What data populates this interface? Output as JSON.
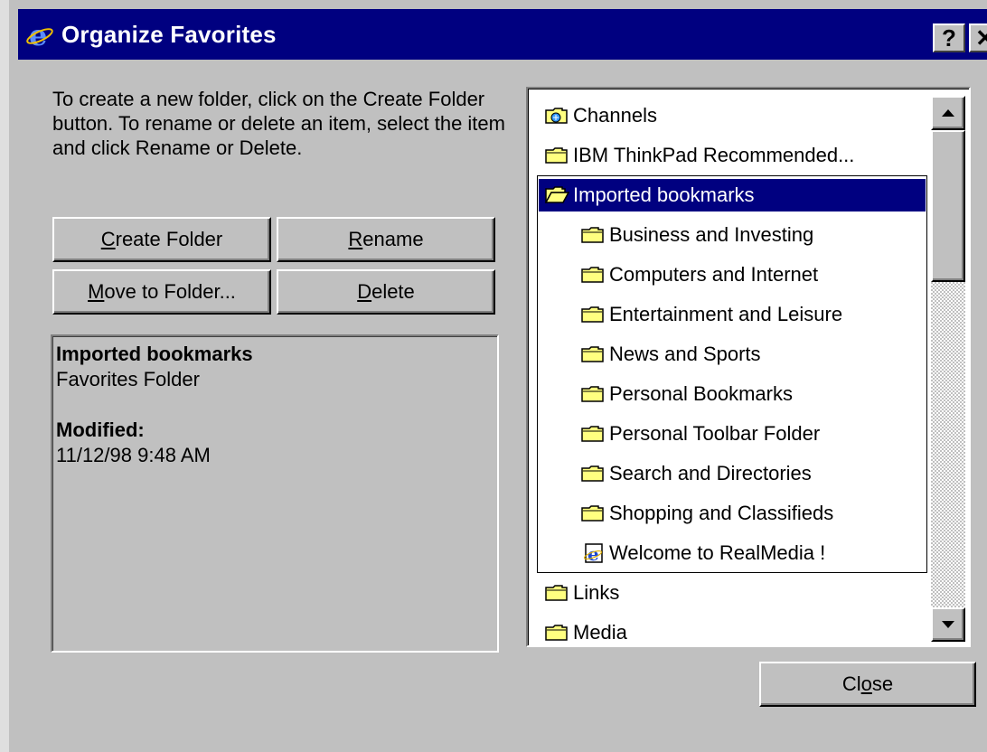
{
  "window": {
    "title": "Organize Favorites",
    "help_glyph": "?",
    "close_glyph": "✕"
  },
  "instructions": "To create a new folder, click on the Create Folder button. To rename or delete an item, select the item and click Rename or Delete.",
  "buttons": {
    "create_folder": {
      "mnemonic": "C",
      "rest": "reate Folder"
    },
    "rename": {
      "mnemonic": "R",
      "rest": "ename"
    },
    "move_to_folder": {
      "mnemonic": "M",
      "rest": "ove to Folder..."
    },
    "delete": {
      "mnemonic": "D",
      "rest": "elete"
    },
    "close": {
      "pre": "Cl",
      "mnemonic": "o",
      "rest": "se"
    }
  },
  "info": {
    "name": "Imported bookmarks",
    "type": "Favorites Folder",
    "modified_label": "Modified:",
    "modified_value": "11/12/98 9:48 AM"
  },
  "tree": {
    "items": [
      {
        "label": "Channels",
        "icon": "channels-icon"
      },
      {
        "label": "IBM ThinkPad Recommended...",
        "icon": "folder-icon"
      },
      {
        "label": "Imported bookmarks",
        "icon": "open-folder-icon",
        "selected": true
      },
      {
        "label": "Business and Investing",
        "icon": "folder-icon"
      },
      {
        "label": "Computers and Internet",
        "icon": "folder-icon"
      },
      {
        "label": "Entertainment and Leisure",
        "icon": "folder-icon"
      },
      {
        "label": "News and Sports",
        "icon": "folder-icon"
      },
      {
        "label": "Personal Bookmarks",
        "icon": "folder-icon"
      },
      {
        "label": "Personal Toolbar Folder",
        "icon": "folder-icon"
      },
      {
        "label": "Search and Directories",
        "icon": "folder-icon"
      },
      {
        "label": "Shopping and Classifieds",
        "icon": "folder-icon"
      },
      {
        "label": "Welcome to RealMedia !",
        "icon": "ie-link-icon"
      },
      {
        "label": "Links",
        "icon": "folder-icon"
      },
      {
        "label": "Media",
        "icon": "folder-icon"
      }
    ]
  },
  "colors": {
    "title_bar": "#000080",
    "face": "#c0c0c0",
    "selection": "#000080",
    "folder": "#ffff80"
  }
}
